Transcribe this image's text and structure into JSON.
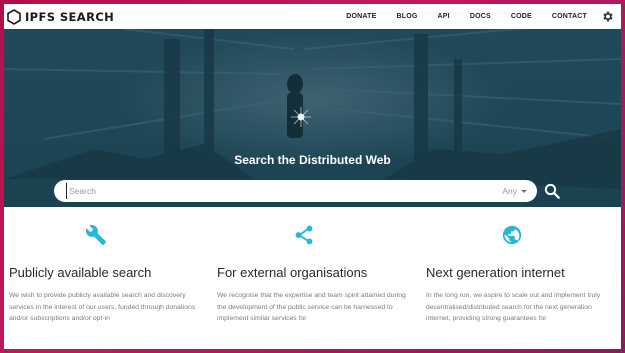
{
  "brand": {
    "name": "IPFS SEARCH",
    "logo_icon": "hexagon-icon"
  },
  "nav": {
    "items": [
      "DONATE",
      "BLOG",
      "API",
      "DOCS",
      "CODE",
      "CONTACT"
    ],
    "settings_icon": "gear-icon"
  },
  "hero": {
    "title": "Search the Distributed Web",
    "search_placeholder": "Search",
    "search_value": "",
    "scope_selected": "Any",
    "search_button_icon": "search-icon"
  },
  "features": [
    {
      "icon": "wrench-icon",
      "title": "Publicly available search",
      "text": "We wish to provide publicly available search and discovery services in the interest of our users, funded through donations and/or subscriptions and/or opt-in"
    },
    {
      "icon": "share-icon",
      "title": "For external organisations",
      "text": "We recognise that the expertise and team spirit attained during the development of the public service can be harnessed to implement similar services for"
    },
    {
      "icon": "globe-icon",
      "title": "Next generation internet",
      "text": "In the long run, we aspire to scale out and implement truly decentralised/distributed search for the next generation internet, providing strong guarantees for"
    }
  ],
  "colors": {
    "accent": "#29b6d8",
    "hero_background": "#1f4757",
    "frame_border": "#b0104d",
    "title_text": "#2a2a2a",
    "body_text": "#7c7c7c"
  }
}
